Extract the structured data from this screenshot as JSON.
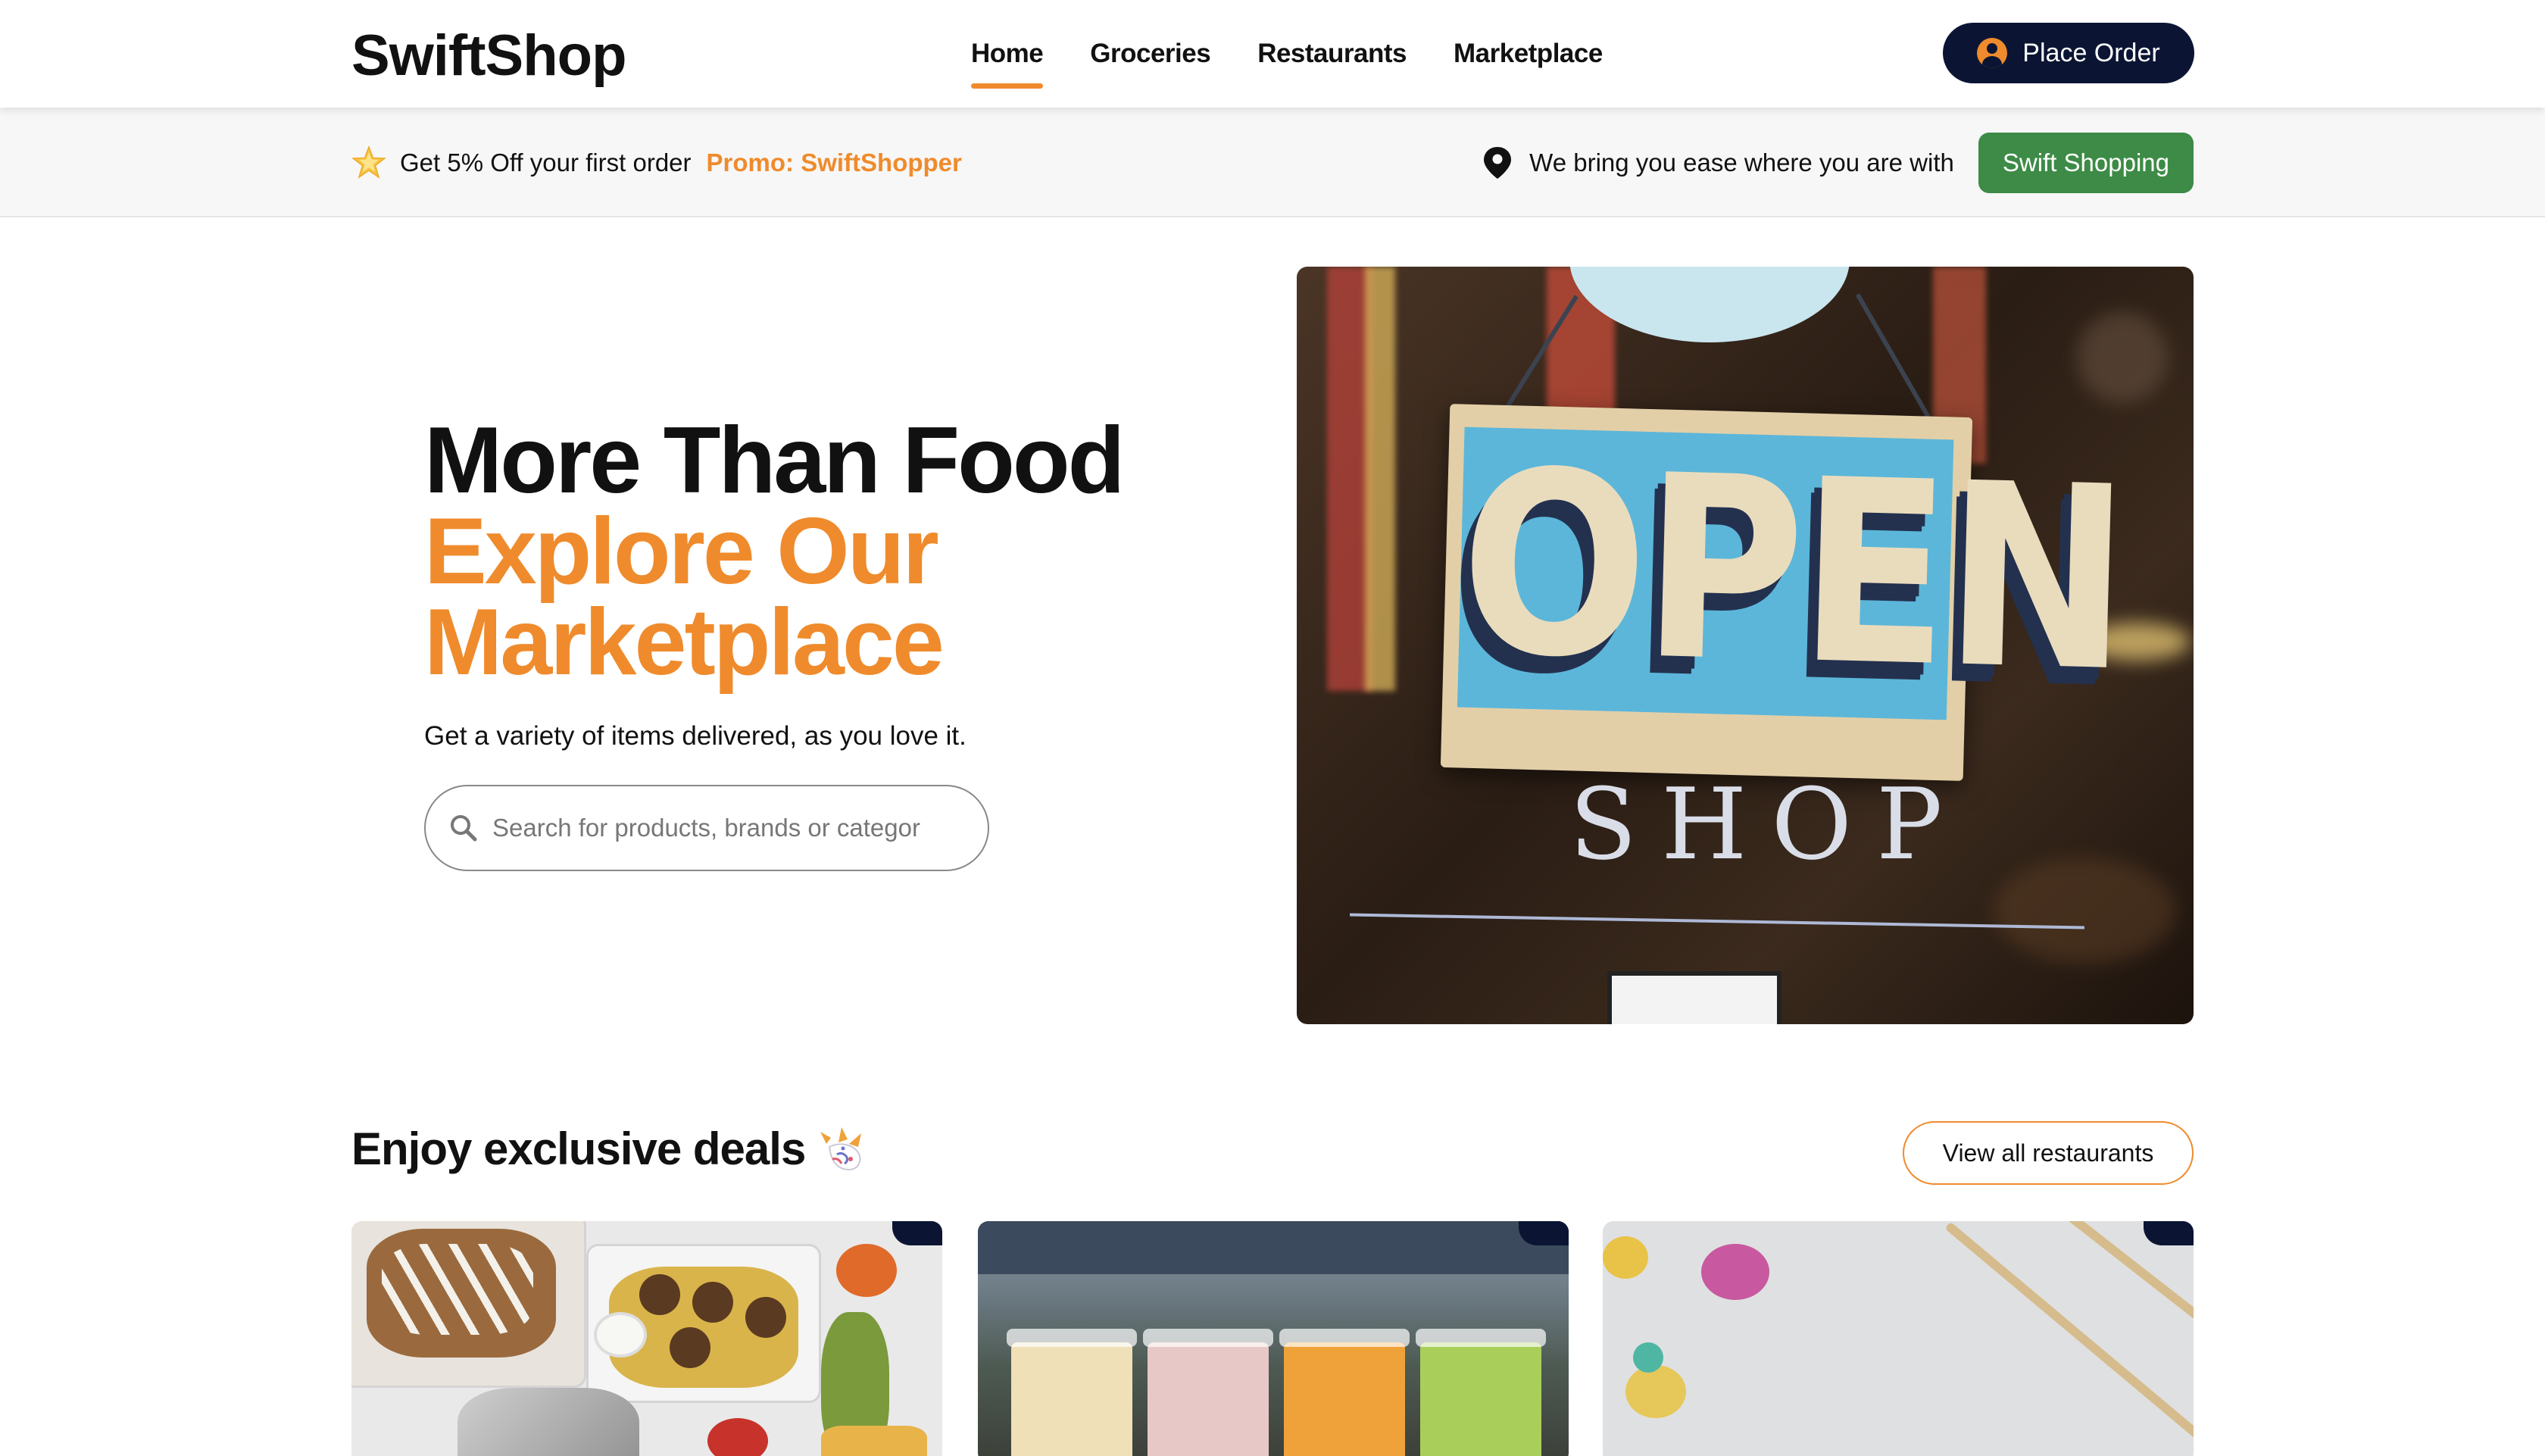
{
  "header": {
    "logo": "SwiftShop",
    "nav": [
      "Home",
      "Groceries",
      "Restaurants",
      "Marketplace"
    ],
    "active_nav": "Home",
    "place_order_label": "Place Order"
  },
  "promo": {
    "offer_text": "Get 5% Off your first order",
    "promo_code": "Promo: SwiftShopper",
    "location_text": "We bring you ease where you are with",
    "swift_button": "Swift Shopping"
  },
  "hero": {
    "title_line1": "More Than Food",
    "title_line2": "Explore Our",
    "title_line3": "Marketplace",
    "subtitle": "Get a variety of items delivered, as you love it.",
    "search_placeholder": "Search for products, brands or categor",
    "image_sign_word": "OPEN",
    "image_sign_caption": "SHOP"
  },
  "deals": {
    "title": "Enjoy exclusive deals",
    "view_all_label": "View all restaurants",
    "cards": [
      {
        "image": "food-platter"
      },
      {
        "image": "bubble-tea-cups"
      },
      {
        "image": "stationery-pencils"
      }
    ]
  },
  "colors": {
    "accent": "#ef8b2c",
    "navy": "#0b1533",
    "green": "#3d8b46"
  },
  "icons": [
    "star-icon",
    "location-pin-icon",
    "user-icon",
    "search-icon",
    "party-popper-icon"
  ]
}
